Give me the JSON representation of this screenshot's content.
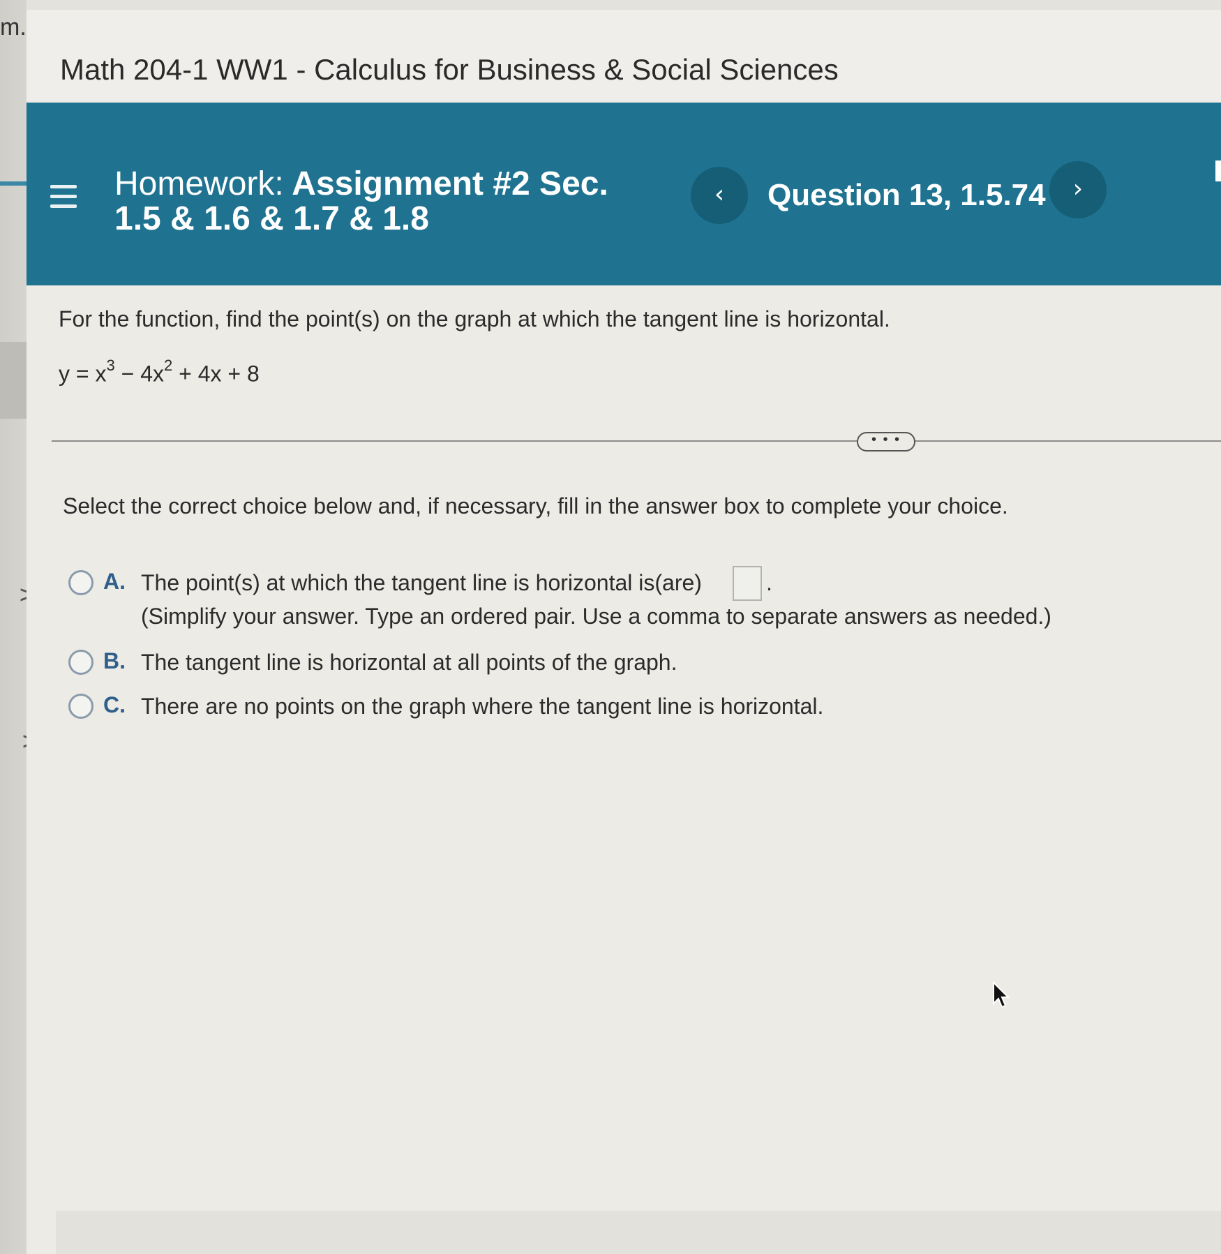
{
  "gutter": {
    "fragment": "m.",
    "chevrons": [
      ">",
      ">",
      ">"
    ]
  },
  "course": {
    "title": "Math 204-1 WW1 - Calculus for Business & Social Sciences"
  },
  "header": {
    "homework_prefix": "Homework:",
    "assignment_title_line1": "Assignment #2 Sec.",
    "assignment_title_line2": "1.5 & 1.6 & 1.7 & 1.8",
    "prev_symbol": "‹",
    "next_symbol": "›",
    "question_label": "Question 13, 1.5.74",
    "band_color": "#1f7390"
  },
  "question": {
    "prompt": "For the function, find the point(s) on the graph at which the tangent line is horizontal.",
    "equation": {
      "lhs": "y = x",
      "exp1": "3",
      "mid": " − 4x",
      "exp2": "2",
      "rest": " + 4x + 8"
    },
    "more_button": "• • •",
    "instructions": "Select the correct choice below and, if necessary, fill in the answer box to complete your choice.",
    "choices": [
      {
        "letter": "A.",
        "text": "The point(s) at which the tangent line is horizontal is(are)",
        "answer_value": "",
        "period": ".",
        "hint": "(Simplify your answer. Type an ordered pair. Use a comma to separate answers as needed.)"
      },
      {
        "letter": "B.",
        "text": "The tangent line is horizontal at all points of the graph."
      },
      {
        "letter": "C.",
        "text": "There are no points on the graph where the tangent line is horizontal."
      }
    ]
  },
  "colors": {
    "choice_letter": "#2f5f8a",
    "radio_border": "#8a9bab"
  }
}
